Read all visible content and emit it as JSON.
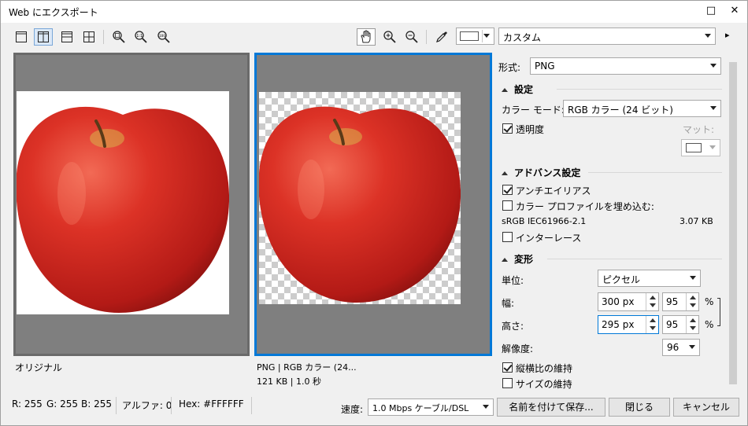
{
  "window": {
    "title": "Web にエクスポート",
    "maximize_glyph": "□",
    "close_glyph": "✕"
  },
  "toolbar": {
    "icons": [
      "single-view-icon",
      "split-view-icon",
      "horizontal-split-icon",
      "quad-view-icon",
      "zoom-fit-icon",
      "zoom-1to1-icon",
      "zoom-100-icon",
      "pan-hand-icon",
      "zoom-in-icon",
      "zoom-out-icon",
      "eyedropper-icon"
    ],
    "preset": "カスタム",
    "more_glyph": "▸"
  },
  "previews": {
    "original_label": "オリジナル",
    "result_line1": "PNG  |  RGB カラー (24...",
    "result_line2": "121 KB  |  1.0 秒"
  },
  "panel": {
    "format_label": "形式:",
    "format_value": "PNG",
    "settings_header": "設定",
    "color_mode_label": "カラー モード:",
    "color_mode_value": "RGB カラー (24 ビット)",
    "transparency_label": "透明度",
    "matte_label": "マット:",
    "advanced_header": "アドバンス設定",
    "antialias_label": "アンチエイリアス",
    "embed_profile_label": "カラー プロファイルを埋め込む:",
    "profile_name": "sRGB IEC61966-2.1",
    "profile_size": "3.07 KB",
    "interlace_label": "インターレース",
    "transform_header": "変形",
    "unit_label": "単位:",
    "unit_value": "ピクセル",
    "width_label": "幅:",
    "width_value": "300 px",
    "width_pct": "95",
    "height_label": "高さ:",
    "height_value": "295 px",
    "height_pct": "95",
    "pct_symbol": "%",
    "resolution_label": "解像度:",
    "resolution_value": "96",
    "keep_ratio_label": "縦横比の維持",
    "keep_size_label": "サイズの維持"
  },
  "status": {
    "r": "R: 255",
    "g": "G: 255",
    "b": "B: 255",
    "alpha": "アルファ: 0",
    "hex": "Hex: #FFFFFF",
    "speed_label": "速度:",
    "speed_value": "1.0 Mbps ケーブル/DSL"
  },
  "buttons": {
    "save": "名前を付けて保存...",
    "close": "閉じる",
    "cancel": "キャンセル"
  },
  "colors": {
    "accent": "#0078d7",
    "preview_bg": "#7f7f7f",
    "apple_red": "#d42a22"
  }
}
